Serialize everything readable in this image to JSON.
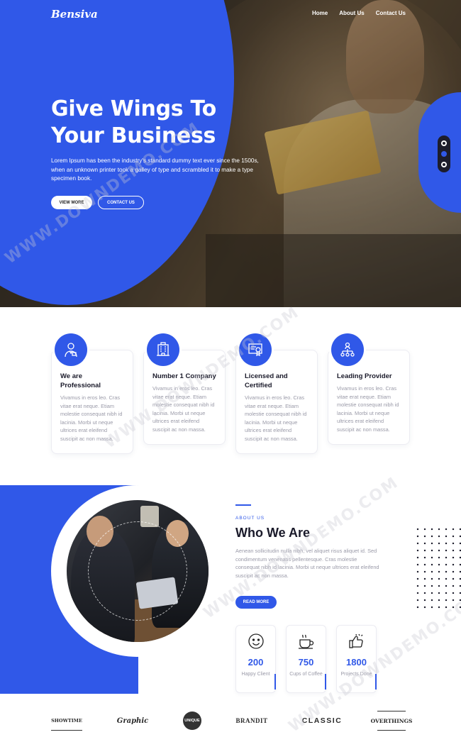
{
  "colors": {
    "primary": "#3058e8",
    "dark_text": "#1a1a2a",
    "muted_text": "#9a9aa8"
  },
  "nav": {
    "logo": "Bensiva",
    "links": [
      "Home",
      "About Us",
      "Contact Us"
    ]
  },
  "hero": {
    "title": "Give Wings To Your Business",
    "text": "Lorem Ipsum has been the industry's standard dummy text ever since the 1500s, when an unknown printer took a galley of type and scrambled it to make a type specimen book.",
    "btn_view": "VIEW MORE",
    "btn_contact": "CONTACT US"
  },
  "features": [
    {
      "title": "We are Professional",
      "text": "Vivamus in eros leo. Cras vitae erat neque. Etiam molestie consequat nibh id lacinia. Morbi ut neque ultrices erat eleifend suscipit ac non massa.",
      "icon": "professional-icon"
    },
    {
      "title": "Number 1 Company",
      "text": "Vivamus in eros leo. Cras vitae erat neque. Etiam molestie consequat nibh id lacinia. Morbi ut neque ultrices erat eleifend suscipit ac non massa.",
      "icon": "company-building-icon"
    },
    {
      "title": "Licensed and Certified",
      "text": "Vivamus in eros leo. Cras vitae erat neque. Etiam molestie consequat nibh id lacinia. Morbi ut neque ultrices erat eleifend suscipit ac non massa.",
      "icon": "certificate-icon"
    },
    {
      "title": "Leading Provider",
      "text": "Vivamus in eros leo. Cras vitae erat neque. Etiam molestie consequat nibh id lacinia. Morbi ut neque ultrices erat eleifend suscipit ac non massa.",
      "icon": "network-icon"
    }
  ],
  "about": {
    "eyebrow": "ABOUT US",
    "title": "Who We Are",
    "text": "Aenean sollicitudin nulla nibh, vel aliquet risus aliquet id. Sed condimentum venenatis pellentesque. Cras molestie consequat nibh id lacinia. Morbi ut neque ultrices erat eleifend suscipit ac non massa.",
    "btn_read": "READ MORE"
  },
  "stats": [
    {
      "value": "200",
      "label": "Happy Client",
      "icon": "smiley-icon"
    },
    {
      "value": "750",
      "label": "Cups of Coffee",
      "icon": "coffee-cup-icon"
    },
    {
      "value": "1800",
      "label": "Projects Done",
      "icon": "thumbs-up-icon"
    }
  ],
  "brands": [
    "SHOWTIME",
    "Graphic",
    "UNIQUE",
    "BRANDIT",
    "CLASSIC",
    "OVERTHINGS"
  ],
  "watermark": "WWW.DOWNDEMO.COM"
}
